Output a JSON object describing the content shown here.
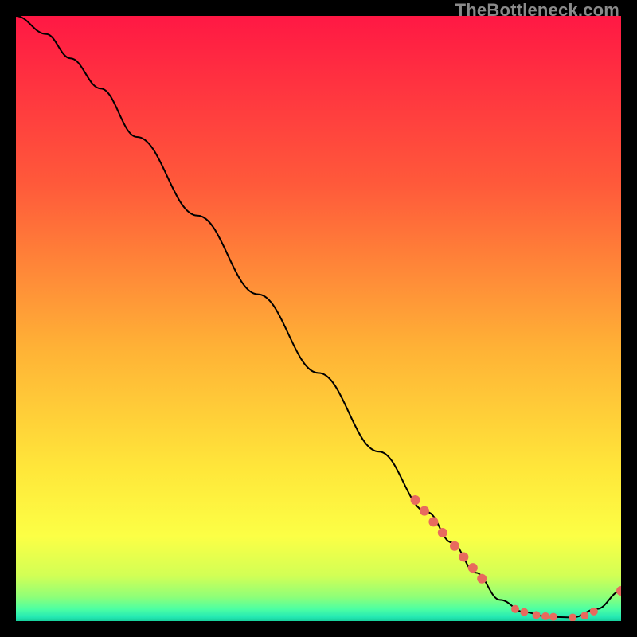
{
  "watermark": "TheBottleneck.com",
  "chart_data": {
    "type": "line",
    "title": "",
    "xlabel": "",
    "ylabel": "",
    "xlim_pct": [
      0,
      100
    ],
    "ylim_pct": [
      0,
      100
    ],
    "series": [
      {
        "name": "bottleneck-curve",
        "x": [
          0,
          5,
          9,
          14,
          20,
          30,
          40,
          50,
          60,
          68,
          72,
          76,
          80,
          84,
          88,
          92,
          96,
          100
        ],
        "y": [
          100,
          97,
          93,
          88,
          80,
          67,
          54,
          41,
          28,
          18,
          13,
          8,
          3.5,
          1.5,
          0.7,
          0.6,
          2,
          5
        ]
      }
    ],
    "markers": {
      "name": "highlighted-points",
      "color": "#e86a5e",
      "points": [
        {
          "x": 66,
          "y": 20,
          "r": 6
        },
        {
          "x": 67.5,
          "y": 18.2,
          "r": 6
        },
        {
          "x": 69,
          "y": 16.4,
          "r": 6
        },
        {
          "x": 70.5,
          "y": 14.6,
          "r": 6
        },
        {
          "x": 72.5,
          "y": 12.4,
          "r": 6
        },
        {
          "x": 74,
          "y": 10.6,
          "r": 6
        },
        {
          "x": 75.5,
          "y": 8.8,
          "r": 6
        },
        {
          "x": 77,
          "y": 7,
          "r": 6
        },
        {
          "x": 82.5,
          "y": 2,
          "r": 5
        },
        {
          "x": 84,
          "y": 1.5,
          "r": 5
        },
        {
          "x": 86,
          "y": 1,
          "r": 5
        },
        {
          "x": 87.5,
          "y": 0.8,
          "r": 5
        },
        {
          "x": 88.8,
          "y": 0.7,
          "r": 5
        },
        {
          "x": 92,
          "y": 0.6,
          "r": 5
        },
        {
          "x": 94,
          "y": 0.9,
          "r": 5
        },
        {
          "x": 95.5,
          "y": 1.6,
          "r": 5
        },
        {
          "x": 100,
          "y": 5,
          "r": 6
        }
      ]
    },
    "gradient_stops": [
      {
        "offset": 0,
        "color": "#ff1844"
      },
      {
        "offset": 28,
        "color": "#ff5a3a"
      },
      {
        "offset": 55,
        "color": "#ffb236"
      },
      {
        "offset": 75,
        "color": "#ffe73a"
      },
      {
        "offset": 86,
        "color": "#fcff45"
      },
      {
        "offset": 92.5,
        "color": "#d2ff55"
      },
      {
        "offset": 96,
        "color": "#8fff78"
      },
      {
        "offset": 98,
        "color": "#4dffa3"
      },
      {
        "offset": 99.3,
        "color": "#25e9b3"
      },
      {
        "offset": 100,
        "color": "#17d19d"
      }
    ]
  }
}
